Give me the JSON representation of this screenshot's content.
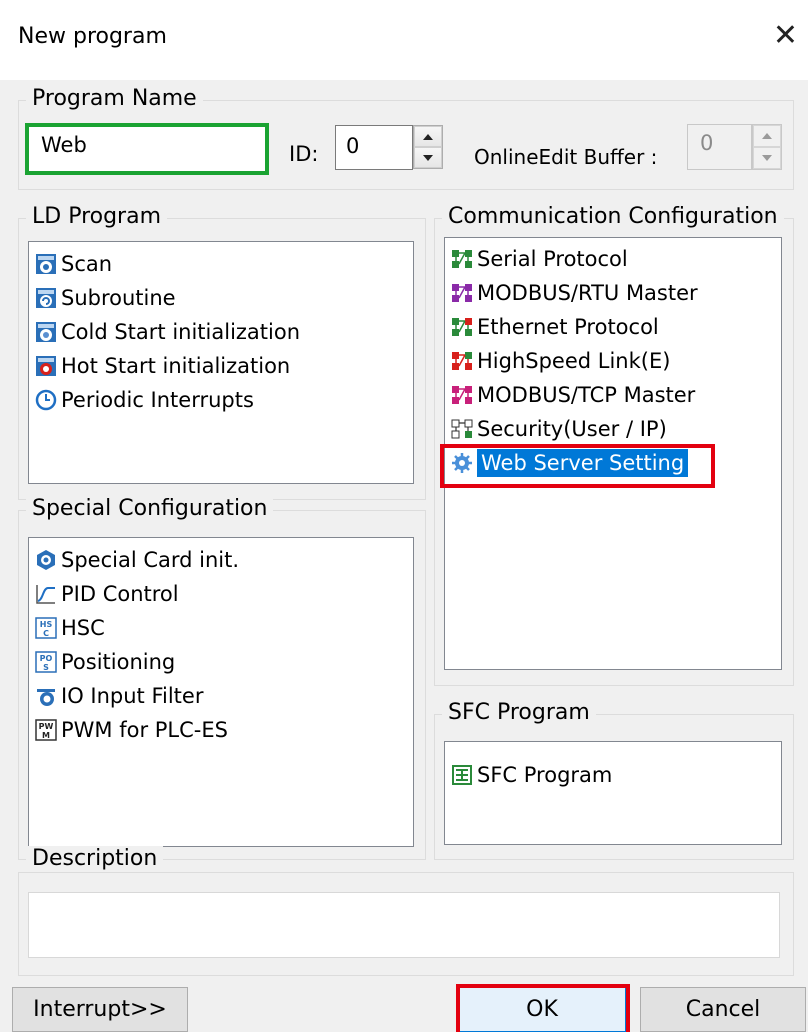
{
  "window": {
    "title": "New program",
    "close_glyph": "✕"
  },
  "program_name": {
    "legend": "Program Name",
    "name_value": "Web",
    "id_label": "ID:",
    "id_value": "0",
    "buffer_label": "OnlineEdit Buffer :",
    "buffer_value": "0"
  },
  "ld_program": {
    "legend": "LD Program",
    "items": [
      {
        "label": "Scan",
        "icon": "scan-icon"
      },
      {
        "label": "Subroutine",
        "icon": "subroutine-icon"
      },
      {
        "label": "Cold Start initialization",
        "icon": "cold-start-icon"
      },
      {
        "label": "Hot Start initialization",
        "icon": "hot-start-icon"
      },
      {
        "label": "Periodic Interrupts",
        "icon": "clock-icon"
      }
    ]
  },
  "communication": {
    "legend": "Communication Configuration",
    "items": [
      {
        "label": "Serial Protocol",
        "icon": "serial-network-icon"
      },
      {
        "label": "MODBUS/RTU Master",
        "icon": "modbus-rtu-network-icon"
      },
      {
        "label": "Ethernet Protocol",
        "icon": "ethernet-network-icon"
      },
      {
        "label": "HighSpeed Link(E)",
        "icon": "highspeed-link-network-icon"
      },
      {
        "label": "MODBUS/TCP Master",
        "icon": "modbus-tcp-network-icon"
      },
      {
        "label": "Security(User / IP)",
        "icon": "security-network-icon"
      },
      {
        "label": "Web Server Setting",
        "icon": "web-gear-icon",
        "selected": true
      }
    ]
  },
  "special": {
    "legend": "Special Configuration",
    "items": [
      {
        "label": "Special Card init.",
        "icon": "special-card-icon"
      },
      {
        "label": "PID Control",
        "icon": "pid-graph-icon"
      },
      {
        "label": "HSC",
        "icon": "hsc-icon"
      },
      {
        "label": "Positioning",
        "icon": "positioning-icon"
      },
      {
        "label": "IO Input Filter",
        "icon": "io-filter-icon"
      },
      {
        "label": "PWM for PLC-ES",
        "icon": "pwm-icon"
      }
    ]
  },
  "sfc": {
    "legend": "SFC Program",
    "items": [
      {
        "label": "SFC Program",
        "icon": "sfc-icon"
      }
    ]
  },
  "description": {
    "legend": "Description",
    "value": ""
  },
  "buttons": {
    "interrupt": "Interrupt>>",
    "ok": "OK",
    "cancel": "Cancel"
  },
  "colors": {
    "highlight_box": "#e3000f",
    "name_box": "#1aa332",
    "selection": "#0078d7"
  }
}
